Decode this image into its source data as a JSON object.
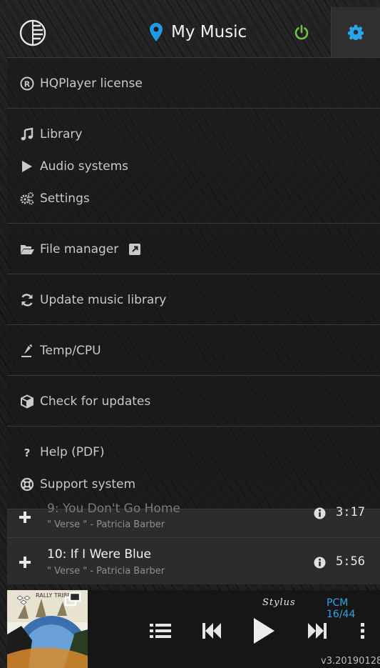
{
  "header": {
    "title": "My Music",
    "logo_icon": "hqplayer-logo-icon",
    "pin_icon": "map-pin-icon",
    "power_icon": "power-icon",
    "settings_icon": "gear-icon",
    "colors": {
      "pin": "#1e9be3",
      "power": "#6cc24a",
      "gear": "#2aa5ea"
    }
  },
  "menu": {
    "license": "HQPlayer license",
    "library": "Library",
    "audio_systems": "Audio systems",
    "settings": "Settings",
    "file_manager": "File manager",
    "update_library": "Update music library",
    "temp_cpu": "Temp/CPU",
    "check_updates": "Check for updates",
    "help": "Help (PDF)",
    "support": "Support system"
  },
  "playlist": [
    {
      "title": "9: You Don't Go Home",
      "subtitle": "\" Verse \" - Patricia Barber",
      "duration": "3:17"
    },
    {
      "title": "10: If I Were Blue",
      "subtitle": "\" Verse \" - Patricia Barber",
      "duration": "5:56"
    }
  ],
  "player": {
    "device": "Stylus",
    "format": "PCM 16/44",
    "version": "v3.20190128",
    "art_text": "RALLY TRIBE",
    "accent": "#2fa4e7"
  }
}
